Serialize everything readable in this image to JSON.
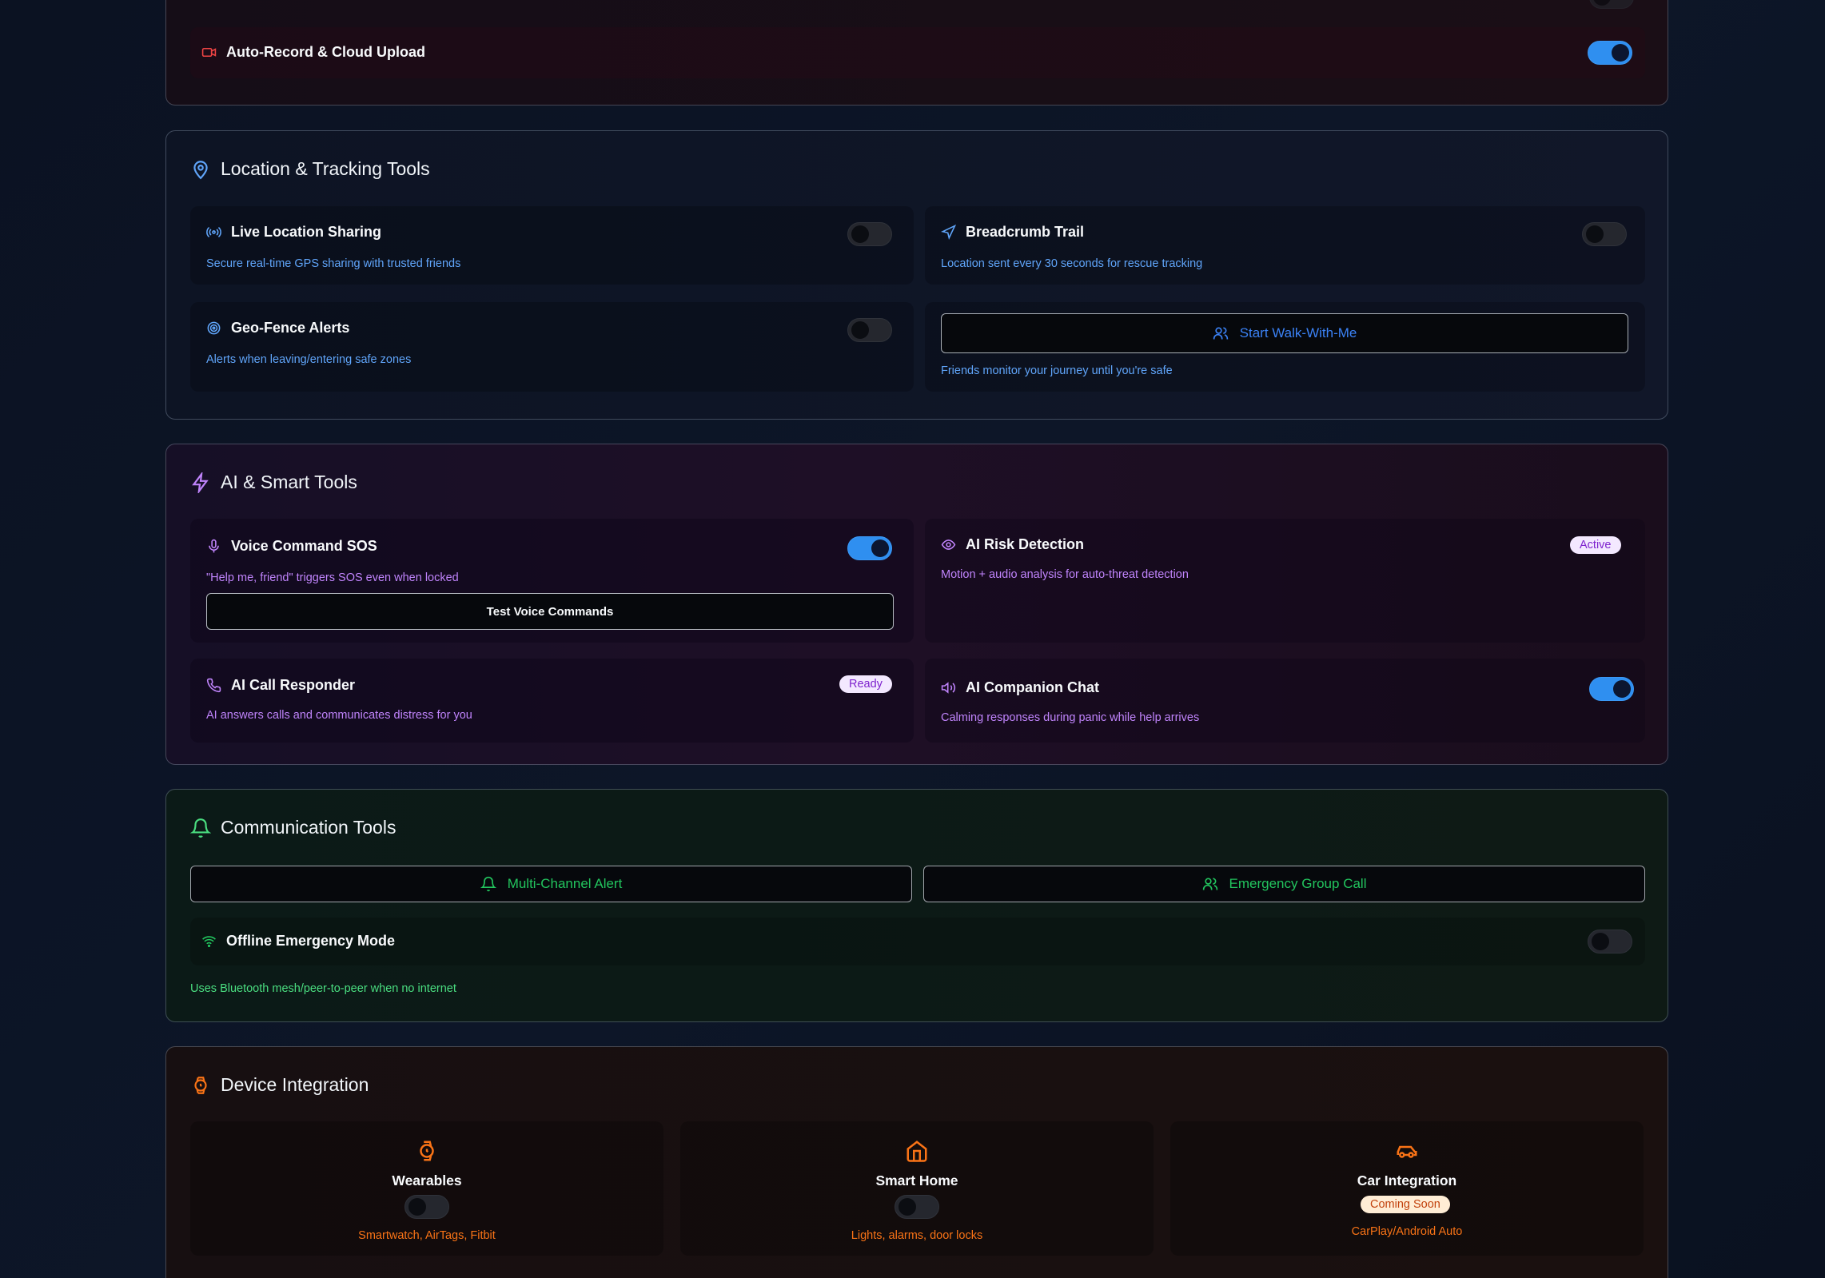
{
  "auto_record": {
    "label": "Auto-Record & Cloud Upload",
    "enabled": true,
    "icon": "video-icon",
    "accent": "#ef4444"
  },
  "location": {
    "title": "Location & Tracking Tools",
    "icon": "map-pin-icon",
    "accent": "#60a5fa",
    "items": [
      {
        "label": "Live Location Sharing",
        "desc": "Secure real-time GPS sharing with trusted friends",
        "icon": "radio-icon",
        "enabled": false
      },
      {
        "label": "Breadcrumb Trail",
        "desc": "Location sent every 30 seconds for rescue tracking",
        "icon": "navigation-icon",
        "enabled": false
      },
      {
        "label": "Geo-Fence Alerts",
        "desc": "Alerts when leaving/entering safe zones",
        "icon": "target-icon",
        "enabled": false
      }
    ],
    "walk_button": "Start Walk-With-Me",
    "walk_desc": "Friends monitor your journey until you're safe"
  },
  "ai": {
    "title": "AI & Smart Tools",
    "icon": "zap-icon",
    "accent": "#c084fc",
    "voice_sos": {
      "label": "Voice Command SOS",
      "desc": "\"Help me, friend\" triggers SOS even when locked",
      "enabled": true,
      "button": "Test Voice Commands"
    },
    "risk": {
      "label": "AI Risk Detection",
      "desc": "Motion + audio analysis for auto-threat detection",
      "badge": "Active"
    },
    "call": {
      "label": "AI Call Responder",
      "desc": "AI answers calls and communicates distress for you",
      "badge": "Ready"
    },
    "companion": {
      "label": "AI Companion Chat",
      "desc": "Calming responses during panic while help arrives",
      "enabled": true
    }
  },
  "communication": {
    "title": "Communication Tools",
    "icon": "bell-icon",
    "accent": "#4ade80",
    "buttons": [
      "Multi-Channel Alert",
      "Emergency Group Call"
    ],
    "offline": {
      "label": "Offline Emergency Mode",
      "enabled": false
    },
    "offline_desc": "Uses Bluetooth mesh/peer-to-peer when no internet"
  },
  "device": {
    "title": "Device Integration",
    "icon": "watch-icon",
    "accent": "#f97316",
    "items": [
      {
        "label": "Wearables",
        "desc": "Smartwatch, AirTags, Fitbit",
        "icon": "watch-icon",
        "enabled": false
      },
      {
        "label": "Smart Home",
        "desc": "Lights, alarms, door locks",
        "icon": "home-icon",
        "enabled": false
      },
      {
        "label": "Car Integration",
        "desc": "CarPlay/Android Auto",
        "icon": "car-icon",
        "badge": "Coming Soon"
      }
    ]
  }
}
